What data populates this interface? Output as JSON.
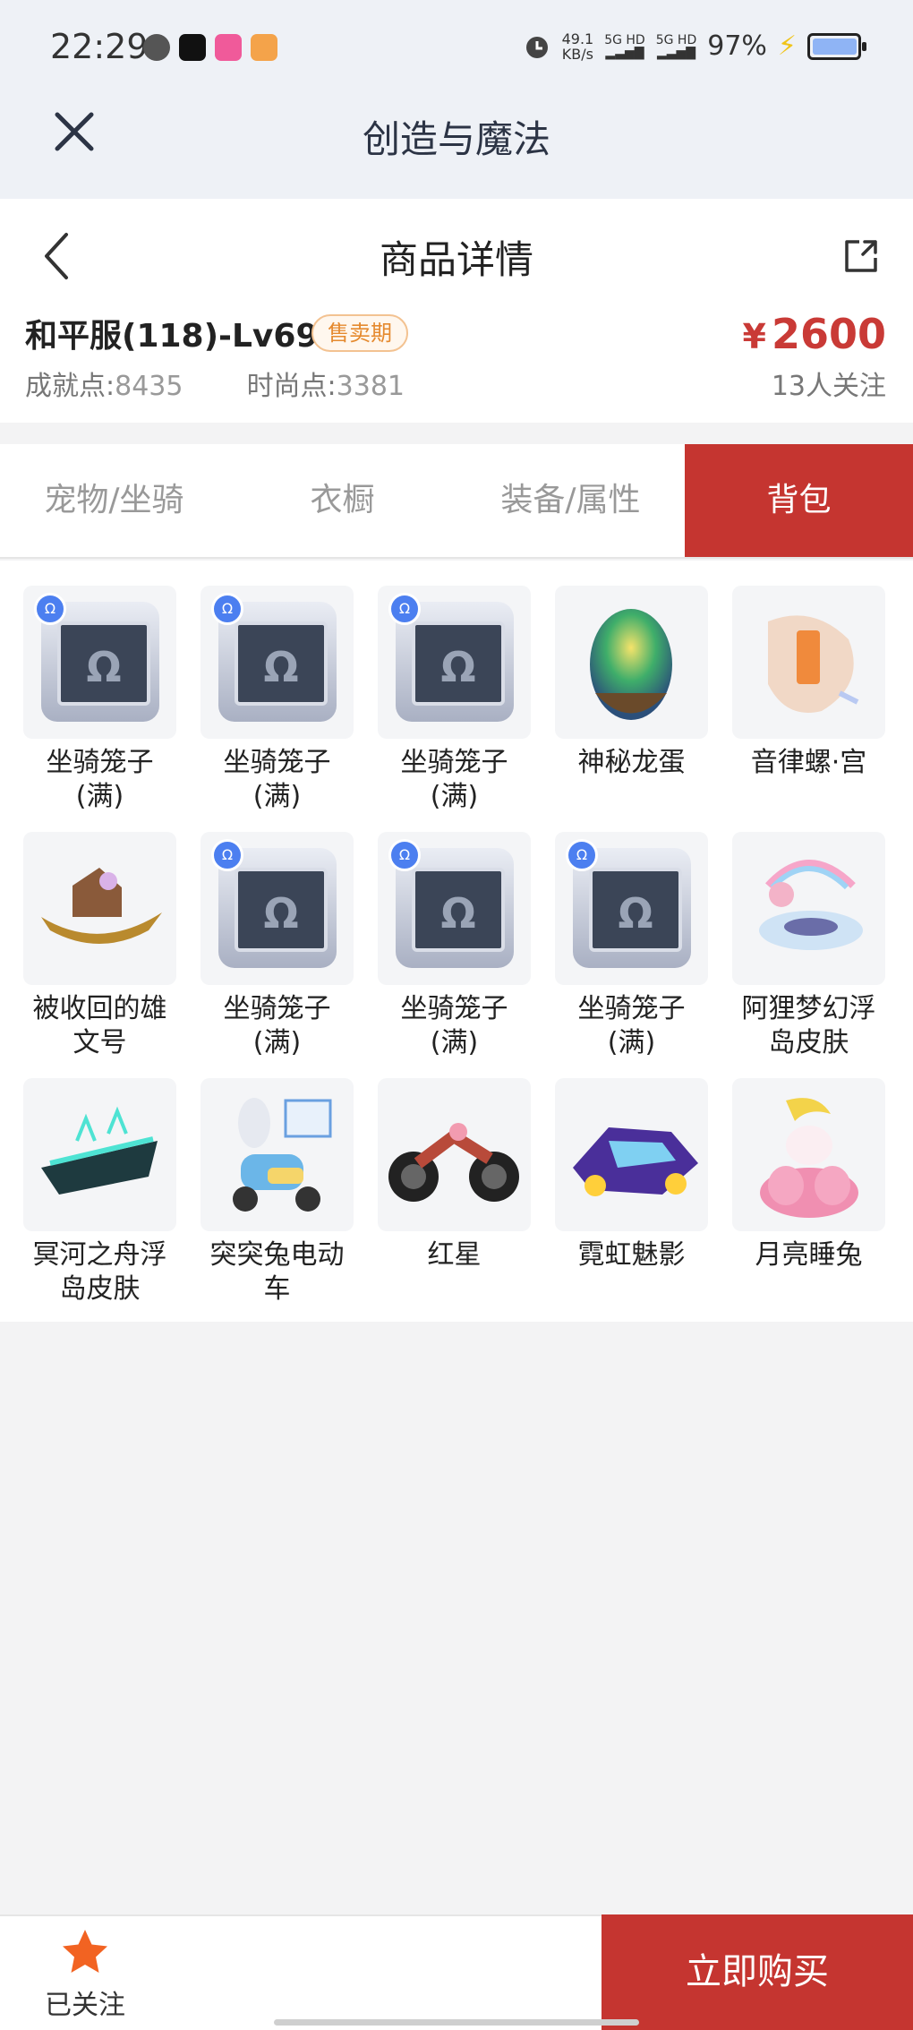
{
  "status_bar": {
    "time": "22:29",
    "net_speed_value": "49.1",
    "net_speed_unit": "KB/s",
    "signal_1": "5G HD",
    "signal_2": "5G HD",
    "battery_pct": "97%",
    "battery_level": 0.97,
    "notification_icons": [
      "message-icon",
      "soul-app-icon",
      "lofter-app-icon",
      "mascot-app-icon"
    ]
  },
  "app_bar": {
    "title": "创造与魔法"
  },
  "header": {
    "title": "商品详情",
    "product_name": "和平服(118)-Lv69",
    "sale_badge": "售卖期",
    "price_symbol": "¥",
    "price_value": "2600",
    "followers": "13人关注",
    "achievement_label": "成就点:",
    "achievement_value": "8435",
    "fashion_label": "时尚点:",
    "fashion_value": "3381"
  },
  "tabs": [
    {
      "label": "宠物/坐骑",
      "active": false
    },
    {
      "label": "衣橱",
      "active": false
    },
    {
      "label": "装备/属性",
      "active": false
    },
    {
      "label": "背包",
      "active": true
    }
  ],
  "items": [
    {
      "name": "坐骑笼子",
      "sub": "(满)",
      "icon": "mount-cage-icon"
    },
    {
      "name": "坐骑笼子",
      "sub": "(满)",
      "icon": "mount-cage-icon"
    },
    {
      "name": "坐骑笼子",
      "sub": "(满)",
      "icon": "mount-cage-icon"
    },
    {
      "name": "神秘龙蛋",
      "sub": "",
      "icon": "dragon-egg-icon"
    },
    {
      "name": "音律螺·宫",
      "sub": "",
      "icon": "conch-icon"
    },
    {
      "name": "被收回的雄",
      "sub": "文号",
      "icon": "ship-icon"
    },
    {
      "name": "坐骑笼子",
      "sub": "(满)",
      "icon": "mount-cage-icon"
    },
    {
      "name": "坐骑笼子",
      "sub": "(满)",
      "icon": "mount-cage-icon"
    },
    {
      "name": "坐骑笼子",
      "sub": "(满)",
      "icon": "mount-cage-icon"
    },
    {
      "name": "阿狸梦幻浮",
      "sub": "岛皮肤",
      "icon": "floating-island-icon"
    },
    {
      "name": "冥河之舟浮",
      "sub": "岛皮肤",
      "icon": "styx-boat-icon"
    },
    {
      "name": "突突兔电动",
      "sub": "车",
      "icon": "scooter-icon"
    },
    {
      "name": "红星",
      "sub": "",
      "icon": "motorcycle-icon"
    },
    {
      "name": "霓虹魅影",
      "sub": "",
      "icon": "neon-car-icon"
    },
    {
      "name": "月亮睡兔",
      "sub": "",
      "icon": "moon-rabbit-icon"
    }
  ],
  "bottom": {
    "follow_label": "已关注",
    "buy_label": "立即购买"
  },
  "colors": {
    "accent": "#c53530",
    "price": "#c93a36",
    "badge": "#e58a2f",
    "star": "#f26322"
  }
}
